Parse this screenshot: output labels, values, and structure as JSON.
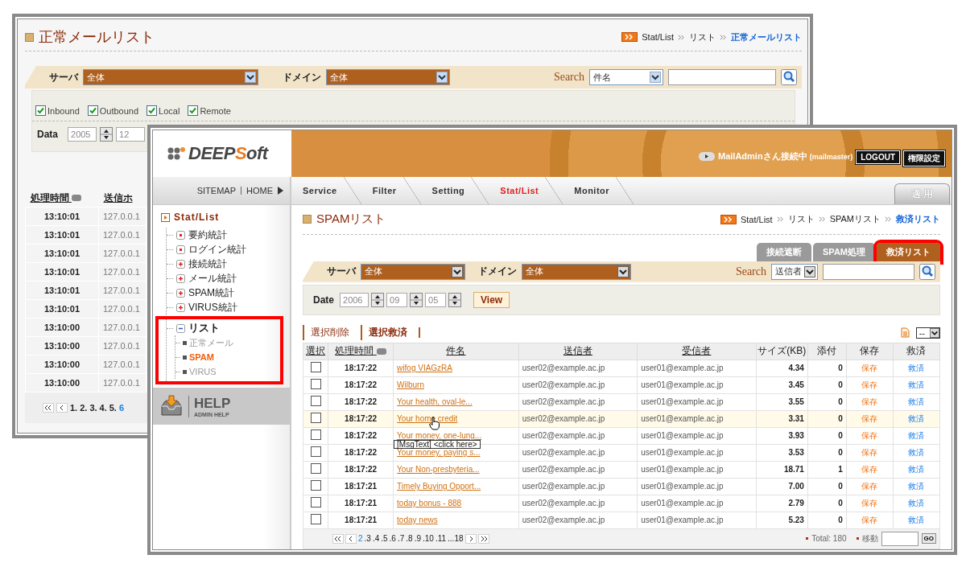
{
  "back_window": {
    "title": "正常メールリスト",
    "breadcrumb": [
      {
        "label": "Stat/List",
        "selected": false
      },
      {
        "label": "リスト",
        "selected": false
      },
      {
        "label": "正常メールリスト",
        "selected": true
      }
    ],
    "filter": {
      "server_label": "サーバ",
      "server_value": "全体",
      "domain_label": "ドメイン",
      "domain_value": "全体",
      "search_label": "Search",
      "search_field": "件名"
    },
    "directions": [
      {
        "label": "Inbound",
        "checked": true
      },
      {
        "label": "Outbound",
        "checked": true
      },
      {
        "label": "Local",
        "checked": true
      },
      {
        "label": "Remote",
        "checked": true
      }
    ],
    "date": {
      "label": "Data",
      "year": "2005",
      "month": "12"
    },
    "table": {
      "columns": [
        "処理時間",
        "送信ホ"
      ],
      "rows": [
        [
          "13:10:01",
          "127.0.0.1"
        ],
        [
          "13:10:01",
          "127.0.0.1"
        ],
        [
          "13:10:01",
          "127.0.0.1"
        ],
        [
          "13:10:01",
          "127.0.0.1"
        ],
        [
          "13:10:01",
          "127.0.0.1"
        ],
        [
          "13:10:01",
          "127.0.0.1"
        ],
        [
          "13:10:00",
          "127.0.0.1"
        ],
        [
          "13:10:00",
          "127.0.0.1"
        ],
        [
          "13:10:00",
          "127.0.0.1"
        ],
        [
          "13:10:00",
          "127.0.0.1"
        ]
      ]
    },
    "pager": [
      {
        "label": "1.",
        "selected": false
      },
      {
        "label": "2.",
        "selected": false
      },
      {
        "label": "3.",
        "selected": false
      },
      {
        "label": "4.",
        "selected": false
      },
      {
        "label": "5.",
        "selected": false
      },
      {
        "label": "6",
        "selected": true
      }
    ]
  },
  "front_window": {
    "logo": [
      "DEEP",
      "S",
      "oft"
    ],
    "user_status": "MailAdminさん接続中",
    "user_id": "(mailmaster)",
    "header_buttons": [
      "LOGOUT",
      "権限設定"
    ],
    "site_links": [
      "SITEMAP",
      "HOME"
    ],
    "tabs": [
      {
        "label": "Service",
        "selected": false
      },
      {
        "label": "Filter",
        "selected": false
      },
      {
        "label": "Setting",
        "selected": false
      },
      {
        "label": "Stat/List",
        "selected": true
      },
      {
        "label": "Monitor",
        "selected": false
      }
    ],
    "apply_button": "適 用",
    "sidebar": {
      "root": "Stat/List",
      "items": [
        {
          "label": "要約統計",
          "kind": "page"
        },
        {
          "label": "ログイン統計",
          "kind": "page"
        },
        {
          "label": "接続統計",
          "kind": "folder",
          "expanded": false
        },
        {
          "label": "メール統計",
          "kind": "folder",
          "expanded": false
        },
        {
          "label": "SPAM統計",
          "kind": "folder",
          "expanded": false
        },
        {
          "label": "VIRUS統計",
          "kind": "folder",
          "expanded": false
        },
        {
          "label": "リスト",
          "kind": "folder",
          "expanded": true,
          "highlighted": true,
          "children": [
            {
              "label": "正常メール",
              "selected": false
            },
            {
              "label": "SPAM",
              "selected": true
            },
            {
              "label": "VIRUS",
              "selected": false
            }
          ]
        }
      ]
    },
    "help": {
      "title": "HELP",
      "subtitle": "ADMIN HELP"
    },
    "main": {
      "title": "SPAMリスト",
      "breadcrumb": [
        {
          "label": "Stat/List",
          "selected": false
        },
        {
          "label": "リスト",
          "selected": false
        },
        {
          "label": "SPAMリスト",
          "selected": false
        },
        {
          "label": "救済リスト",
          "selected": true
        }
      ],
      "subtabs": [
        {
          "label": "接続遮断",
          "selected": false,
          "highlighted": false
        },
        {
          "label": "SPAM処理",
          "selected": false,
          "highlighted": false
        },
        {
          "label": "救済リスト",
          "selected": true,
          "highlighted": true
        }
      ],
      "filter": {
        "server_label": "サーバ",
        "server_value": "全体",
        "domain_label": "ドメイン",
        "domain_value": "全体",
        "search_label": "Search",
        "search_field": "送信者"
      },
      "date": {
        "label": "Date",
        "year": "2006",
        "month": "09",
        "day": "05",
        "button": "View"
      },
      "actions": [
        {
          "label": "選択削除",
          "bold": false
        },
        {
          "label": "選択救済",
          "bold": true
        }
      ],
      "page_size": "--",
      "table": {
        "columns": [
          "選択",
          "処理時間",
          "件名",
          "送信者",
          "受信者",
          "サイズ(KB)",
          "添付",
          "保存",
          "救済"
        ],
        "rows": [
          {
            "checked": false,
            "hovered": false,
            "time": "18:17:22",
            "subject": "wifog VIAGzRA",
            "sender": "user02@example.ac.jp",
            "recipient": "user01@example.ac.jp",
            "size": "4.34",
            "attachments": "0",
            "save": "保存",
            "rescue": "救済"
          },
          {
            "checked": false,
            "hovered": false,
            "time": "18:17:22",
            "subject": "Wilburn",
            "sender": "user02@example.ac.jp",
            "recipient": "user01@example.ac.jp",
            "size": "3.45",
            "attachments": "0",
            "save": "保存",
            "rescue": "救済"
          },
          {
            "checked": false,
            "hovered": false,
            "time": "18:17:22",
            "subject": "Your health, oval-le...",
            "sender": "user02@example.ac.jp",
            "recipient": "user01@example.ac.jp",
            "size": "3.55",
            "attachments": "0",
            "save": "保存",
            "rescue": "救済"
          },
          {
            "checked": false,
            "hovered": true,
            "time": "18:17:22",
            "subject": "Your home credit",
            "sender": "user02@example.ac.jp",
            "recipient": "user01@example.ac.jp",
            "size": "3.31",
            "attachments": "0",
            "save": "保存",
            "rescue": "救済",
            "tooltip": "[MsgText] <click here>"
          },
          {
            "checked": false,
            "hovered": false,
            "time": "18:17:22",
            "subject": "Your money, one-lung...",
            "sender": "user02@example.ac.jp",
            "recipient": "user01@example.ac.jp",
            "size": "3.93",
            "attachments": "0",
            "save": "保存",
            "rescue": "救済"
          },
          {
            "checked": false,
            "hovered": false,
            "time": "18:17:22",
            "subject": "Your money, paying s...",
            "sender": "user02@example.ac.jp",
            "recipient": "user01@example.ac.jp",
            "size": "3.53",
            "attachments": "0",
            "save": "保存",
            "rescue": "救済"
          },
          {
            "checked": false,
            "hovered": false,
            "time": "18:17:22",
            "subject": "Your Non-presbyteria...",
            "sender": "user02@example.ac.jp",
            "recipient": "user01@example.ac.jp",
            "size": "18.71",
            "attachments": "1",
            "save": "保存",
            "rescue": "救済"
          },
          {
            "checked": false,
            "hovered": false,
            "time": "18:17:21",
            "subject": "Timely Buying Opport...",
            "sender": "user02@example.ac.jp",
            "recipient": "user01@example.ac.jp",
            "size": "7.00",
            "attachments": "0",
            "save": "保存",
            "rescue": "救済"
          },
          {
            "checked": false,
            "hovered": false,
            "time": "18:17:21",
            "subject": "today bonus - 888",
            "sender": "user02@example.ac.jp",
            "recipient": "user01@example.ac.jp",
            "size": "2.79",
            "attachments": "0",
            "save": "保存",
            "rescue": "救済"
          },
          {
            "checked": false,
            "hovered": false,
            "time": "18:17:21",
            "subject": "today news",
            "sender": "user02@example.ac.jp",
            "recipient": "user01@example.ac.jp",
            "size": "5.23",
            "attachments": "0",
            "save": "保存",
            "rescue": "救済"
          }
        ]
      },
      "pager": [
        {
          "label": "2",
          "selected": true
        },
        {
          "label": ".3",
          "selected": false
        },
        {
          "label": ".4",
          "selected": false
        },
        {
          "label": ".5",
          "selected": false
        },
        {
          "label": ".6",
          "selected": false
        },
        {
          "label": ".7",
          "selected": false
        },
        {
          "label": ".8",
          "selected": false
        },
        {
          "label": ".9",
          "selected": false
        },
        {
          "label": ".10",
          "selected": false
        },
        {
          "label": ".11",
          "selected": false
        },
        {
          "label": "...18",
          "selected": false
        }
      ],
      "total": "Total: 180",
      "jump_label": "移動",
      "go_button": "GO"
    }
  }
}
